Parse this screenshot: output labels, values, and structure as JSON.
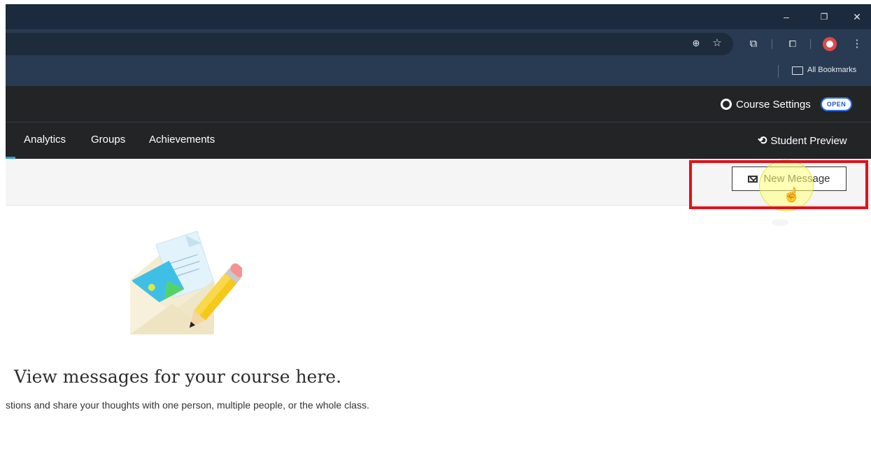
{
  "browser": {
    "window_controls": {
      "minimize": "–",
      "restore": "❐",
      "close": "✕"
    },
    "toolbar_icons": [
      "zoom-icon",
      "bookmark-star-icon",
      "extensions-icon",
      "tab-search-icon",
      "profile-avatar",
      "menu-icon"
    ],
    "bookmarks_bar": {
      "all_bookmarks_label": "All Bookmarks"
    }
  },
  "course_header": {
    "course_settings_label": "Course Settings",
    "open_badge": "OPEN"
  },
  "course_nav": {
    "items": [
      {
        "label": "Analytics"
      },
      {
        "label": "Groups"
      },
      {
        "label": "Achievements"
      }
    ],
    "student_preview_label": "Student Preview"
  },
  "messages": {
    "new_message_label": "New Message",
    "empty_state_title": "View messages for your course here.",
    "empty_state_subtitle": "stions and share your thoughts with one person, multiple people, or the whole class."
  },
  "colors": {
    "annotation_box": "#e3101a",
    "header_bg": "#222426",
    "browser_bg": "#283b52",
    "badge_blue": "#1a56c6",
    "nav_accent": "#2aa0d8"
  }
}
